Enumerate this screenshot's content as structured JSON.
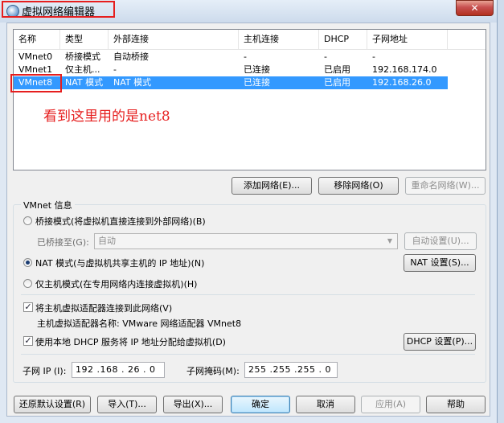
{
  "window": {
    "title": "虚拟网络编辑器",
    "close_glyph": "✕"
  },
  "netlist": {
    "columns": [
      "名称",
      "类型",
      "外部连接",
      "主机连接",
      "DHCP",
      "子网地址"
    ],
    "rows": [
      {
        "name": "VMnet0",
        "type": "桥接模式",
        "external": "自动桥接",
        "host": "-",
        "dhcp": "-",
        "subnet": "-"
      },
      {
        "name": "VMnet1",
        "type": "仅主机...",
        "external": "-",
        "host": "已连接",
        "dhcp": "已启用",
        "subnet": "192.168.174.0"
      },
      {
        "name": "VMnet8",
        "type": "NAT 模式",
        "external": "NAT 模式",
        "host": "已连接",
        "dhcp": "已启用",
        "subnet": "192.168.26.0"
      }
    ],
    "selected_index": 2,
    "annotation": "看到这里用的是net8"
  },
  "list_buttons": {
    "add": "添加网络(E)...",
    "remove": "移除网络(O)",
    "rename": "重命名网络(W)..."
  },
  "vmnet_info": {
    "legend": "VMnet 信息",
    "bridged_radio": "桥接模式(将虚拟机直接连接到外部网络)(B)",
    "bridged_to_label": "已桥接至(G):",
    "bridged_to_value": "自动",
    "auto_settings": "自动设置(U)...",
    "nat_radio": "NAT 模式(与虚拟机共享主机的 IP 地址)(N)",
    "nat_settings": "NAT 设置(S)...",
    "hostonly_radio": "仅主机模式(在专用网络内连接虚拟机)(H)",
    "connect_adapter_check": "将主机虚拟适配器连接到此网络(V)",
    "adapter_name": "主机虚拟适配器名称: VMware 网络适配器 VMnet8",
    "dhcp_check": "使用本地 DHCP 服务将 IP 地址分配给虚拟机(D)",
    "dhcp_settings": "DHCP 设置(P)...",
    "subnet_ip_label": "子网 IP (I):",
    "subnet_ip_value": "192 .168 . 26 . 0",
    "subnet_mask_label": "子网掩码(M):",
    "subnet_mask_value": "255 .255 .255 . 0",
    "check_glyph": "✓"
  },
  "footer": {
    "restore": "还原默认设置(R)",
    "import": "导入(T)...",
    "export": "导出(X)...",
    "ok": "确定",
    "cancel": "取消",
    "apply": "应用(A)",
    "help": "帮助"
  },
  "colors": {
    "selection": "#3399ff",
    "annotation": "#e61e1e"
  }
}
